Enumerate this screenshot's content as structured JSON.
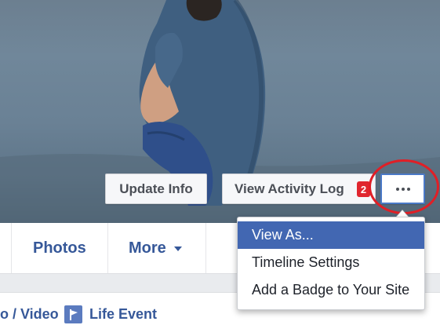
{
  "cover": {
    "update_info_label": "Update Info",
    "activity_log_label": "View Activity Log",
    "activity_badge_count": "2",
    "more_button_icon": "ellipsis-icon"
  },
  "nav": {
    "tabs": [
      {
        "label": "Photos"
      },
      {
        "label": "More"
      }
    ]
  },
  "composer": {
    "photo_video_label": "o / Video",
    "life_event_label": "Life Event",
    "life_event_icon": "flag-icon"
  },
  "menu": {
    "items": [
      {
        "label": "View As...",
        "active": true
      },
      {
        "label": "Timeline Settings",
        "active": false
      },
      {
        "label": "Add a Badge to Your Site",
        "active": false
      }
    ]
  },
  "colors": {
    "link_blue": "#365899",
    "menu_highlight": "#4267b2",
    "badge_red": "#e0262e",
    "annotation_red": "#e01f26"
  }
}
